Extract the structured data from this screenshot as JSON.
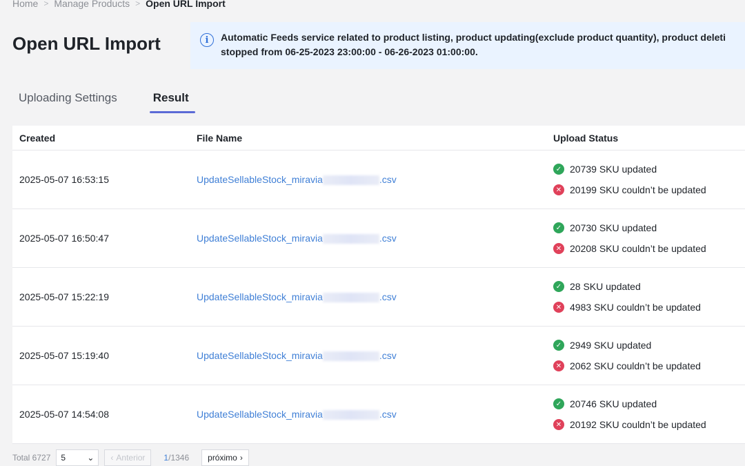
{
  "breadcrumb": {
    "items": [
      "Home",
      "Manage Products"
    ],
    "current": "Open URL Import",
    "separator": ">"
  },
  "page": {
    "title": "Open URL Import"
  },
  "notice": {
    "icon": "info-icon",
    "line1": "Automatic Feeds service related to product listing, product updating(exclude product quantity), product deleti",
    "line2": "stopped from 06-25-2023 23:00:00 - 06-26-2023 01:00:00."
  },
  "tabs": [
    {
      "label": "Uploading Settings",
      "active": false
    },
    {
      "label": "Result",
      "active": true
    }
  ],
  "table": {
    "headers": {
      "created": "Created",
      "file": "File Name",
      "status": "Upload Status"
    },
    "rows": [
      {
        "created": "2025-05-07 16:53:15",
        "file_prefix": "UpdateSellableStock_miravia",
        "file_suffix": ".csv",
        "ok": "20739 SKU updated",
        "err": "20199 SKU couldn’t be updated"
      },
      {
        "created": "2025-05-07 16:50:47",
        "file_prefix": "UpdateSellableStock_miravia",
        "file_suffix": ".csv",
        "ok": "20730 SKU updated",
        "err": "20208 SKU couldn’t be updated"
      },
      {
        "created": "2025-05-07 15:22:19",
        "file_prefix": "UpdateSellableStock_miravia",
        "file_suffix": ".csv",
        "ok": "28 SKU updated",
        "err": "4983 SKU couldn’t be updated"
      },
      {
        "created": "2025-05-07 15:19:40",
        "file_prefix": "UpdateSellableStock_miravia",
        "file_suffix": ".csv",
        "ok": "2949 SKU updated",
        "err": "2062 SKU couldn’t be updated"
      },
      {
        "created": "2025-05-07 14:54:08",
        "file_prefix": "UpdateSellableStock_miravia",
        "file_suffix": ".csv",
        "ok": "20746 SKU updated",
        "err": "20192 SKU couldn’t be updated"
      }
    ]
  },
  "pager": {
    "total_label": "Total 6727",
    "page_size": "5",
    "prev_label": "Anterior",
    "current_page": "1",
    "total_pages": "/1346",
    "next_label": "próximo"
  },
  "colors": {
    "accent": "#5b6ad6",
    "link": "#3f7fd6",
    "success": "#2fa65a",
    "error": "#e0415a",
    "notice_bg": "#eaf3ff"
  }
}
